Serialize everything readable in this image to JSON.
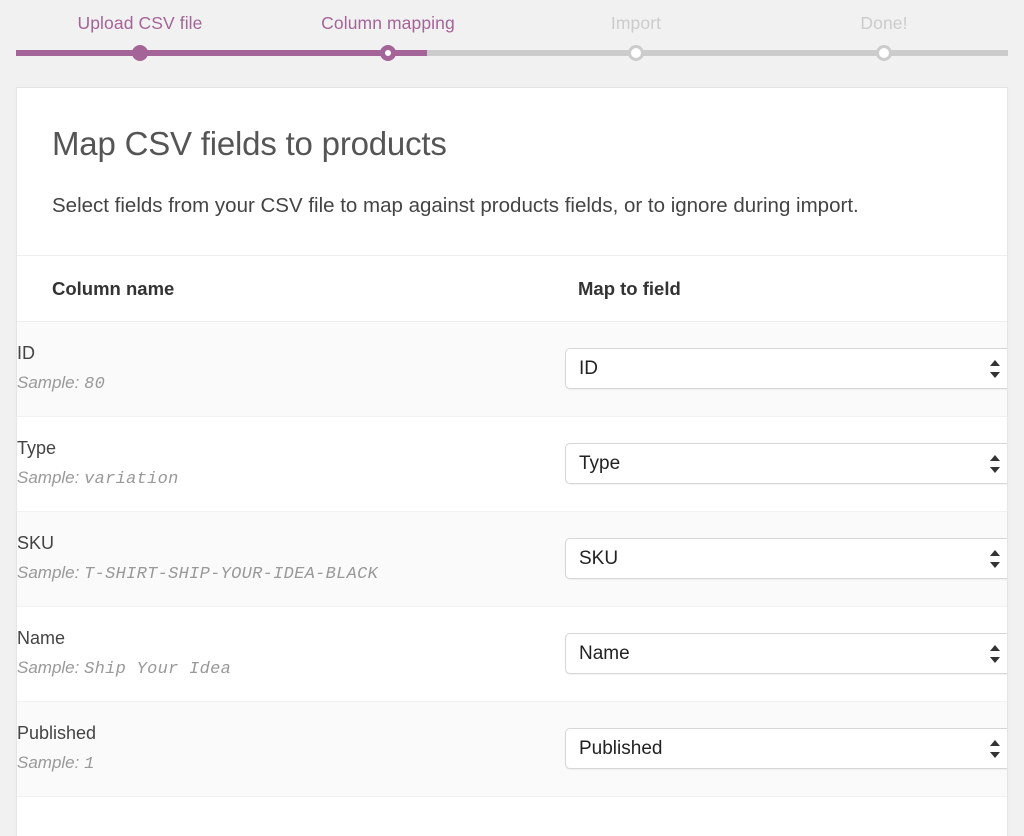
{
  "stepper": {
    "steps": [
      {
        "label": "Upload CSV file",
        "state": "done"
      },
      {
        "label": "Column mapping",
        "state": "active"
      },
      {
        "label": "Import",
        "state": "todo"
      },
      {
        "label": "Done!",
        "state": "todo"
      }
    ],
    "accent_color": "#a46497",
    "inactive_color": "#cccccc",
    "progress_percent": 41.4
  },
  "card": {
    "title": "Map CSV fields to products",
    "description": "Select fields from your CSV file to map against products fields, or to ignore during import."
  },
  "table": {
    "headers": {
      "column_name": "Column name",
      "map_to_field": "Map to field"
    },
    "sample_prefix": "Sample:",
    "rows": [
      {
        "name": "ID",
        "sample": "80",
        "mapped_field": "ID"
      },
      {
        "name": "Type",
        "sample": "variation",
        "mapped_field": "Type"
      },
      {
        "name": "SKU",
        "sample": "T-SHIRT-SHIP-YOUR-IDEA-BLACK",
        "mapped_field": "SKU"
      },
      {
        "name": "Name",
        "sample": "Ship Your Idea",
        "mapped_field": "Name"
      },
      {
        "name": "Published",
        "sample": "1",
        "mapped_field": "Published"
      }
    ]
  }
}
